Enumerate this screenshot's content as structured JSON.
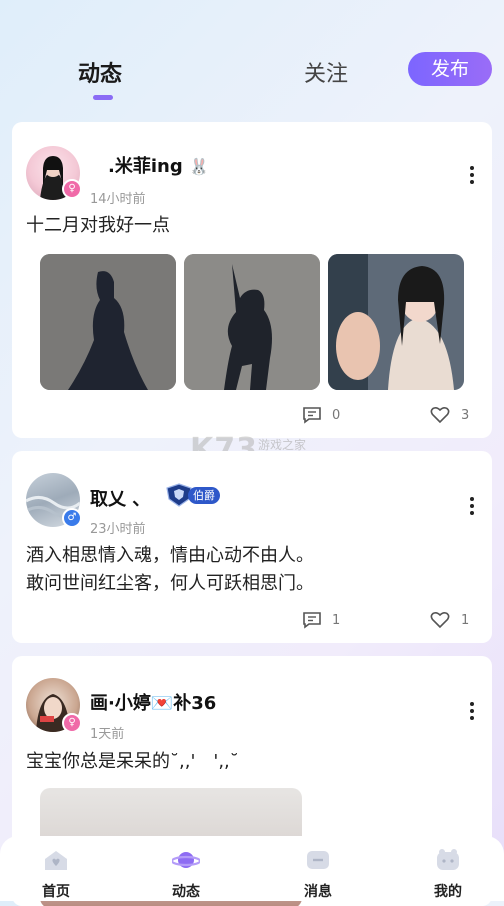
{
  "header": {
    "tab_active": "动态",
    "tab_follow": "关注",
    "publish": "发布"
  },
  "posts": [
    {
      "username": " .米菲ing",
      "user_badge_emoji": "🐰",
      "gender": "female",
      "time": "14小时前",
      "text": "十二月对我好一点",
      "images": [
        "silhouette-girl-1",
        "silhouette-girl-2",
        "selfie-girl"
      ],
      "comments": "0",
      "likes": "3"
    },
    {
      "username": "取乂 、",
      "rank_badge": "伯爵",
      "gender": "male",
      "time": "23小时前",
      "text_line1": "酒入相思情入魂，情由心动不由人。",
      "text_line2": "敢问世间红尘客，何人可跃相思门。",
      "comments": "1",
      "likes": "1"
    },
    {
      "username": "画·小婷💌补36",
      "gender": "female",
      "time": "1天前",
      "text": " 宝宝你总是呆呆的˘,,' ',,˘"
    }
  ],
  "watermark": {
    "text": "K73",
    "sub": "游戏之家"
  },
  "nav": [
    {
      "label": "首页",
      "icon": "home-icon"
    },
    {
      "label": "动态",
      "icon": "planet-icon"
    },
    {
      "label": "消息",
      "icon": "message-icon"
    },
    {
      "label": "我的",
      "icon": "profile-icon"
    }
  ],
  "colors": {
    "accent": "#8a6cf5",
    "female": "#f06aa8",
    "male": "#3a7bea"
  }
}
